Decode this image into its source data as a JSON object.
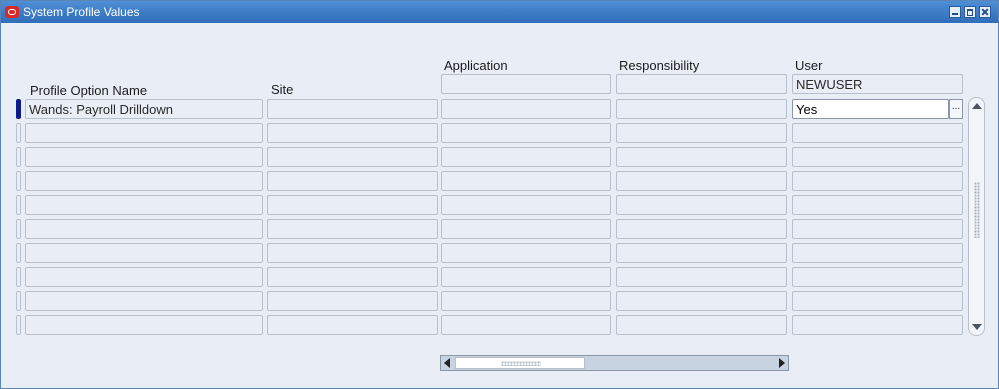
{
  "window": {
    "title": "System Profile Values"
  },
  "columns": {
    "profile_option_name": "Profile Option Name",
    "site": "Site",
    "application": "Application",
    "responsibility": "Responsibility",
    "user": "User"
  },
  "context": {
    "application": "",
    "responsibility": "",
    "user": "NEWUSER"
  },
  "rows": [
    {
      "profile": "Wands: Payroll Drilldown",
      "site": "",
      "application": "",
      "responsibility": "",
      "user": "Yes"
    },
    {
      "profile": "",
      "site": "",
      "application": "",
      "responsibility": "",
      "user": ""
    },
    {
      "profile": "",
      "site": "",
      "application": "",
      "responsibility": "",
      "user": ""
    },
    {
      "profile": "",
      "site": "",
      "application": "",
      "responsibility": "",
      "user": ""
    },
    {
      "profile": "",
      "site": "",
      "application": "",
      "responsibility": "",
      "user": ""
    },
    {
      "profile": "",
      "site": "",
      "application": "",
      "responsibility": "",
      "user": ""
    },
    {
      "profile": "",
      "site": "",
      "application": "",
      "responsibility": "",
      "user": ""
    },
    {
      "profile": "",
      "site": "",
      "application": "",
      "responsibility": "",
      "user": ""
    },
    {
      "profile": "",
      "site": "",
      "application": "",
      "responsibility": "",
      "user": ""
    },
    {
      "profile": "",
      "site": "",
      "application": "",
      "responsibility": "",
      "user": ""
    }
  ],
  "lov_button": "...",
  "icons": {
    "app": "oracle-app-icon",
    "minimize": "minimize-icon",
    "maximize": "maximize-icon",
    "close": "close-icon"
  },
  "colors": {
    "titlebar": "#2f6db8",
    "current_record": "#0d1a8a",
    "field_bg": "#e9eef6"
  }
}
